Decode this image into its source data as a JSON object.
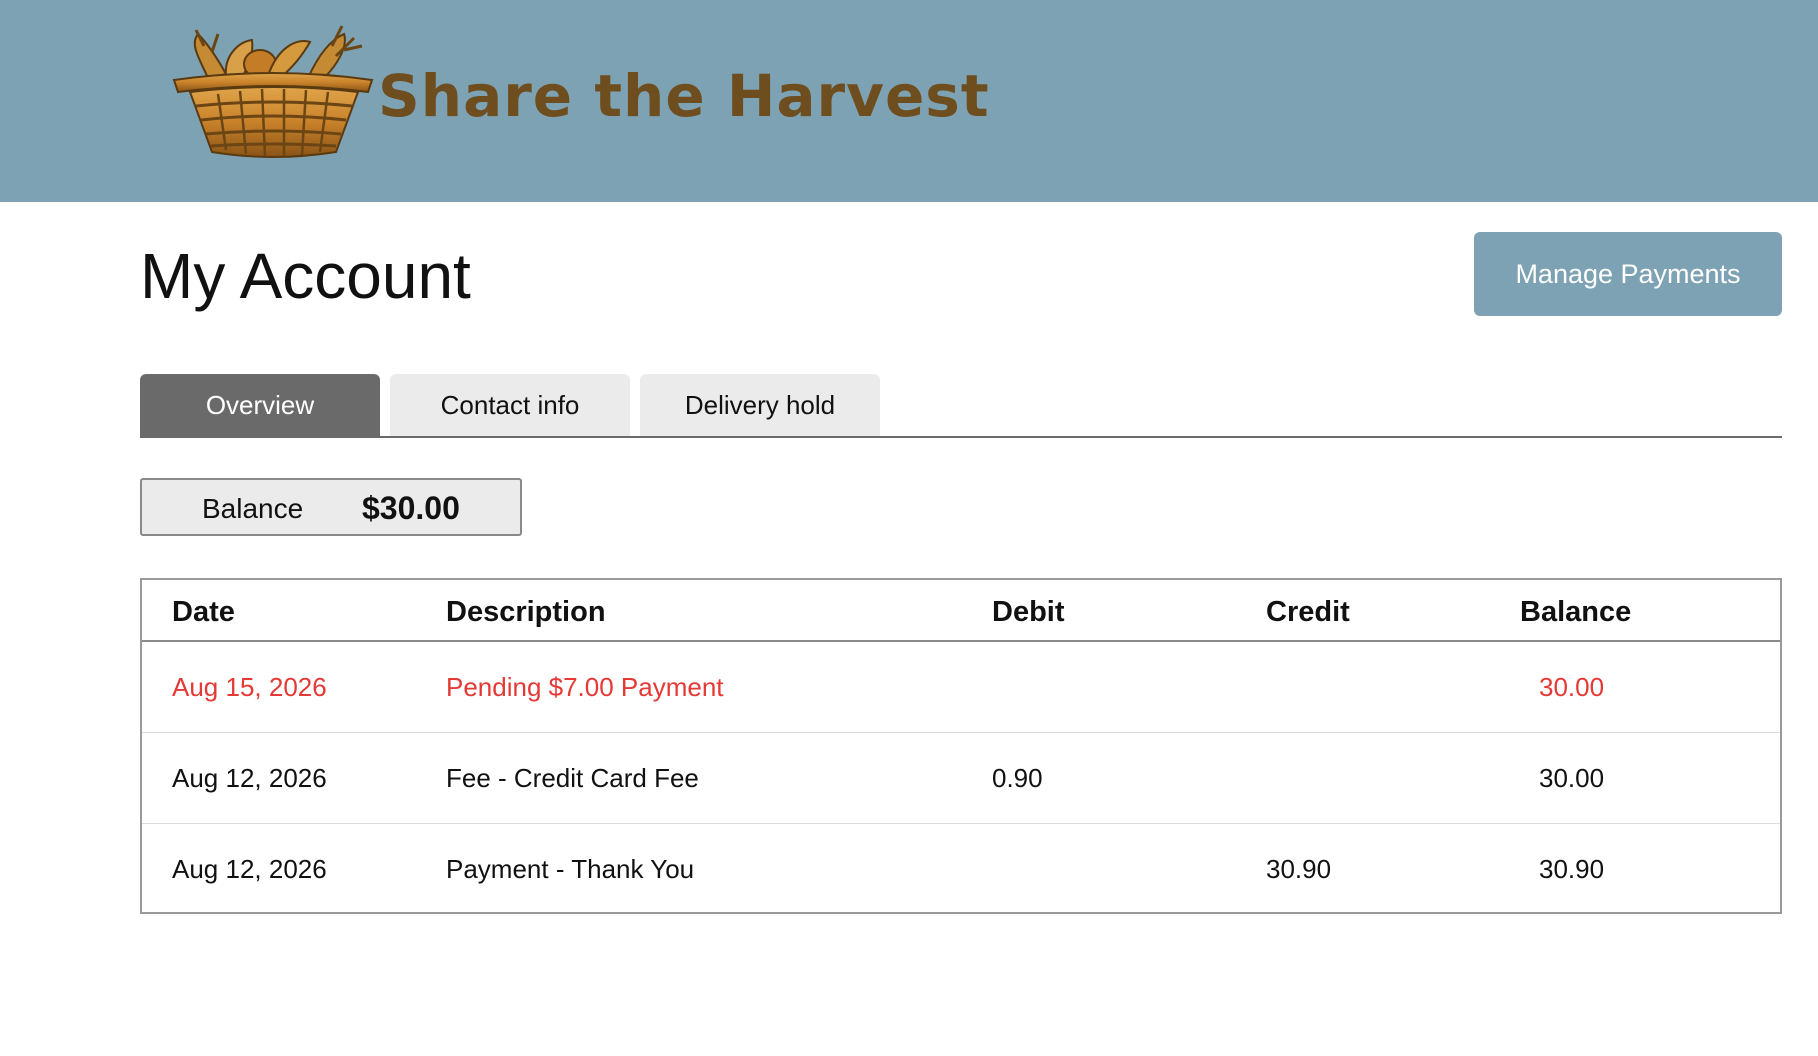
{
  "header": {
    "logo_text": "Share the Harvest",
    "logo_icon": "basket-icon",
    "background_color": "#7da2b3",
    "logo_text_color": "#6e4d1e"
  },
  "page": {
    "title": "My Account"
  },
  "actions": {
    "manage_payments_label": "Manage Payments"
  },
  "tabs": [
    {
      "label": "Overview",
      "active": true
    },
    {
      "label": "Contact info",
      "active": false
    },
    {
      "label": "Delivery hold",
      "active": false
    }
  ],
  "balance": {
    "label": "Balance",
    "value": "$30.00"
  },
  "ledger": {
    "columns": [
      "Date",
      "Description",
      "Debit",
      "Credit",
      "Balance"
    ],
    "rows": [
      {
        "date": "Aug 15, 2026",
        "description": "Pending $7.00 Payment",
        "debit": "",
        "credit": "",
        "balance": "30.00",
        "status": "pending"
      },
      {
        "date": "Aug 12, 2026",
        "description": "Fee - Credit Card Fee",
        "debit": "0.90",
        "credit": "",
        "balance": "30.00",
        "status": "posted"
      },
      {
        "date": "Aug 12, 2026",
        "description": "Payment - Thank You",
        "debit": "",
        "credit": "30.90",
        "balance": "30.90",
        "status": "posted"
      }
    ],
    "pending_color": "#e53935"
  }
}
